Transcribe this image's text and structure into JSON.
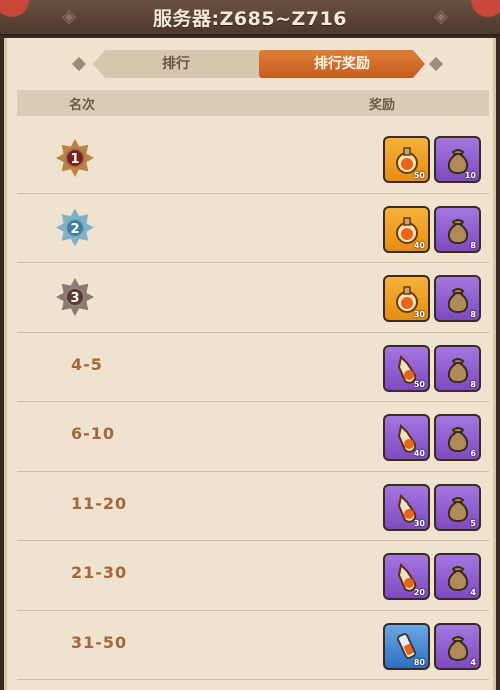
{
  "header": {
    "title": "服务器:Z685~Z716"
  },
  "tabs": [
    {
      "label": "排行"
    },
    {
      "label": "排行奖励"
    }
  ],
  "columns": {
    "rank": "名次",
    "reward": "奖励"
  },
  "rows": [
    {
      "rank": "1",
      "rewards": [
        {
          "color": "orange",
          "icon": "potion-flask-icon",
          "count": "50"
        },
        {
          "color": "purple",
          "icon": "sack-icon",
          "count": "10"
        }
      ]
    },
    {
      "rank": "2",
      "rewards": [
        {
          "color": "orange",
          "icon": "potion-flask-icon",
          "count": "40"
        },
        {
          "color": "purple",
          "icon": "sack-icon",
          "count": "8"
        }
      ]
    },
    {
      "rank": "3",
      "rewards": [
        {
          "color": "orange",
          "icon": "potion-flask-icon",
          "count": "30"
        },
        {
          "color": "purple",
          "icon": "sack-icon",
          "count": "8"
        }
      ]
    },
    {
      "rank": "4-5",
      "rewards": [
        {
          "color": "purple",
          "icon": "potion-bottle-icon",
          "count": "50"
        },
        {
          "color": "purple",
          "icon": "sack-icon",
          "count": "8"
        }
      ]
    },
    {
      "rank": "6-10",
      "rewards": [
        {
          "color": "purple",
          "icon": "potion-bottle-icon",
          "count": "40"
        },
        {
          "color": "purple",
          "icon": "sack-icon",
          "count": "6"
        }
      ]
    },
    {
      "rank": "11-20",
      "rewards": [
        {
          "color": "purple",
          "icon": "potion-bottle-icon",
          "count": "30"
        },
        {
          "color": "purple",
          "icon": "sack-icon",
          "count": "5"
        }
      ]
    },
    {
      "rank": "21-30",
      "rewards": [
        {
          "color": "purple",
          "icon": "potion-bottle-icon",
          "count": "20"
        },
        {
          "color": "purple",
          "icon": "sack-icon",
          "count": "4"
        }
      ]
    },
    {
      "rank": "31-50",
      "rewards": [
        {
          "color": "blue",
          "icon": "potion-vial-icon",
          "count": "80"
        },
        {
          "color": "purple",
          "icon": "sack-icon",
          "count": "4"
        }
      ]
    }
  ]
}
